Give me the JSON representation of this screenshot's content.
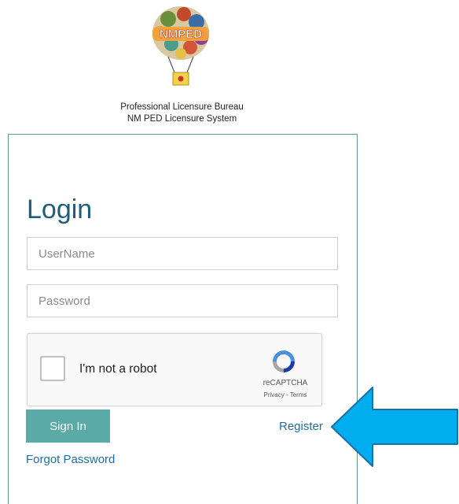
{
  "header": {
    "logo_text": "NMPED",
    "org_line1": "Professional Licensure Bureau",
    "org_line2": "NM PED Licensure System"
  },
  "login": {
    "title": "Login",
    "username_placeholder": "UserName",
    "password_placeholder": "Password",
    "signin_label": "Sign In",
    "register_label": "Register",
    "forgot_label": "Forgot Password"
  },
  "captcha": {
    "label": "I'm not a robot",
    "brand": "reCAPTCHA",
    "terms": "Privacy - Terms"
  },
  "colors": {
    "title": "#1f5d7f",
    "button": "#5aaaa7",
    "link": "#1f6fa3",
    "arrow": "#00aeef"
  },
  "annotation": {
    "icon": "blue-arrow-pointing-left-icon"
  }
}
